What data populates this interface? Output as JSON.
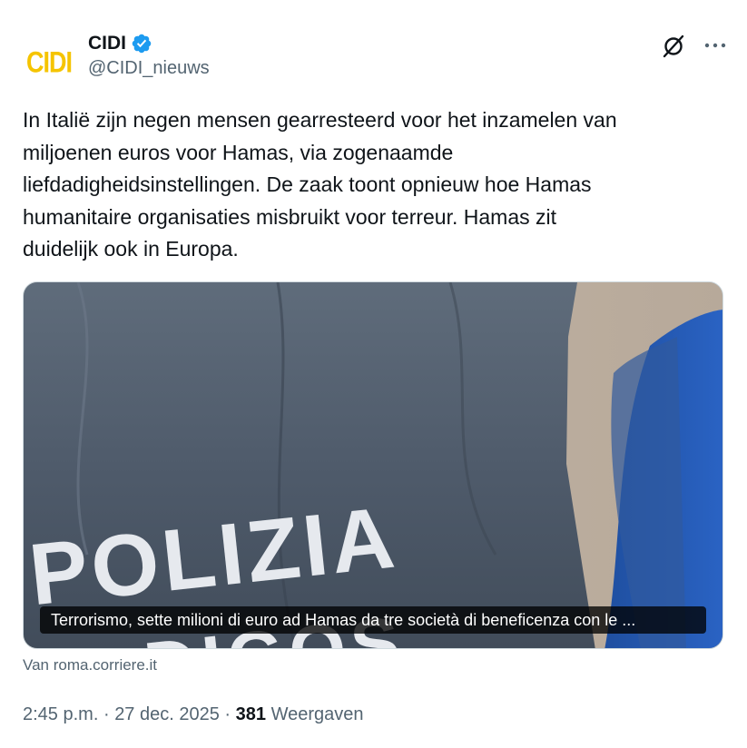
{
  "author": {
    "avatar_text": "CIDI",
    "display_name": "CIDI",
    "handle": "@CIDI_nieuws",
    "verified": true
  },
  "tweet": {
    "text": "In Italië zijn negen mensen gearresteerd voor het inzamelen van\nmiljoenen euros voor Hamas, via zogenaamde\nliefdadigheidsinstellingen. De zaak toont opnieuw hoe Hamas\nhumanitaire organisaties misbruikt voor terreur. Hamas zit\nduidelijk ook in Europa."
  },
  "card": {
    "image_text": "POLIZIA",
    "image_text_partial": "DIGOS",
    "caption": "Terrorismo, sette milioni di euro ad Hamas da tre società di beneficenza con le ...",
    "source": "Van roma.corriere.it"
  },
  "meta": {
    "time": "2:45 p.m.",
    "separator": "·",
    "date": "27 dec. 2025",
    "views_count": "381",
    "views_label": "Weergaven"
  },
  "icons": {
    "verified": "verified-badge-icon",
    "grok": "grok-icon",
    "more": "more-options-icon"
  },
  "colors": {
    "verified": "#1d9bf0",
    "avatar_text": "#f5c400",
    "secondary_text": "#536471",
    "primary_text": "#0f1419"
  }
}
